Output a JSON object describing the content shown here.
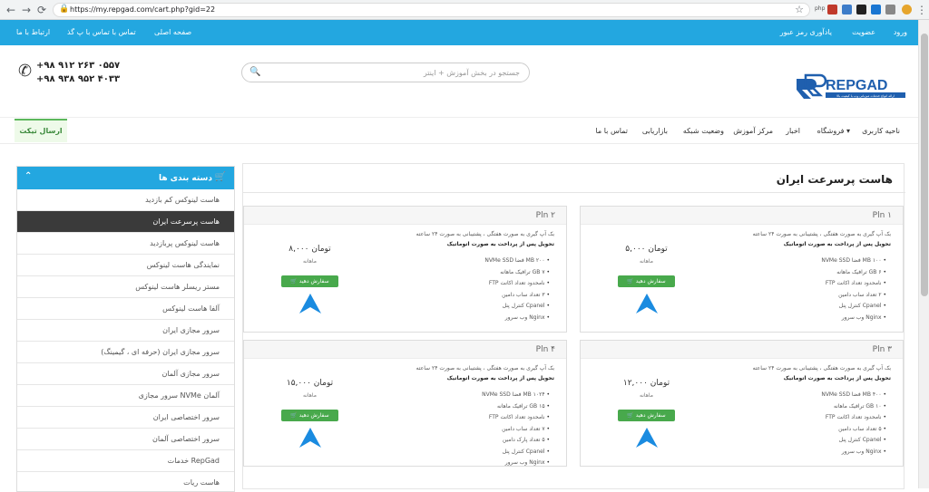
{
  "browser": {
    "url": "https://my.repgad.com/cart.php?gid=22",
    "back": "←",
    "forward": "→",
    "reload": "⟳",
    "home": "⌂",
    "lock": "🔒",
    "star": "☆",
    "ext_label": "php"
  },
  "topbar": {
    "links": [
      "ورود",
      "عضویت",
      "یادآوری رمز عبور"
    ],
    "right_links": [
      "ارتباط با ما",
      "تماس با تماس با پ گذ",
      "صفحه اصلی"
    ]
  },
  "header": {
    "phone1": "+۹۸ ۹۱۲ ۲۶۳ ۰۵۵۷",
    "phone2": "+۹۸ ۹۳۸ ۹۵۲ ۴۰۳۳",
    "search_placeholder": "جستجو در بخش آموزش + اینتر",
    "logo_text": "REPGAD",
    "logo_sub": "ارائه انواع خدمات میزبانی وب با کیفیت بالا"
  },
  "nav": {
    "items": [
      "ناحیه کاربری",
      "فروشگاه",
      "اخبار",
      "مرکز آموزش",
      "وضعیت شبکه",
      "بازاریابی",
      "تماس با ما"
    ],
    "ticket": "ارسال تیکت"
  },
  "sidebar": {
    "title": "دسته بندی ها",
    "items": [
      "هاست لینوکس کم بازدید",
      "هاست پرسرعت ایران",
      "هاست لینوکس پربازدید",
      "نمایندگی هاست لینوکس",
      "مستر ریسلر هاست لینوکس",
      "آلفا هاست لینوکس",
      "سرور مجازی ایران",
      "سرور مجازی ایران (حرفه ای ، گیمینگ)",
      "سرور مجازی آلمان",
      "سرور مجازی NVMe آلمان",
      "سرور اختصاصی ایران",
      "سرور اختصاصی آلمان",
      "خدمات RepGad",
      "هاست ریات"
    ],
    "active_index": 1
  },
  "page": {
    "title": "هاست پرسرعت ایران",
    "order_label": "سفارش دهید",
    "cycle": "ماهانه",
    "desc1": "بک آپ گیری به صورت هفتگی ، پشتیبانی به صورت ۲۴ ساعته",
    "desc2": "تحویل پس از پرداخت به صورت اتوماتیک",
    "plans": [
      {
        "name": "Pln ۱",
        "price": "۵,۰۰۰ تومان",
        "features": [
          "۱۰۰ MB فضا NVMe SSD",
          "۶ GB ترافیک ماهانه",
          "نامحدود تعداد اکانت FTP",
          "۲ تعداد ساب دامین",
          "Cpanel کنترل پنل",
          "Nginx وب سرور"
        ]
      },
      {
        "name": "Pln ۲",
        "price": "۸,۰۰۰ تومان",
        "features": [
          "۲۰۰ MB فضا NVMe SSD",
          "۷ GB ترافیک ماهانه",
          "نامحدود تعداد اکانت FTP",
          "۳ تعداد ساب دامین",
          "Cpanel کنترل پنل",
          "Nginx وب سرور"
        ]
      },
      {
        "name": "Pln ۳",
        "price": "۱۲,۰۰۰ تومان",
        "features": [
          "۴۰۰ MB فضا NVMe SSD",
          "۱۰ GB ترافیک ماهانه",
          "نامحدود تعداد اکانت FTP",
          "۵ تعداد ساب دامین",
          "Cpanel کنترل پنل",
          "Nginx وب سرور"
        ]
      },
      {
        "name": "Pln ۴",
        "price": "۱۵,۰۰۰ تومان",
        "features": [
          "۱۰۲۴ MB فضا NVMe SSD",
          "۱۵ GB ترافیک ماهانه",
          "نامحدود تعداد اکانت FTP",
          "۷ تعداد ساب دامین",
          "۵ تعداد پارک دامین",
          "Cpanel کنترل پنل",
          "Nginx وب سرور"
        ]
      }
    ]
  },
  "colors": {
    "primary": "#23a7e0",
    "green": "#48a94c",
    "dark": "#3a3a3a"
  }
}
